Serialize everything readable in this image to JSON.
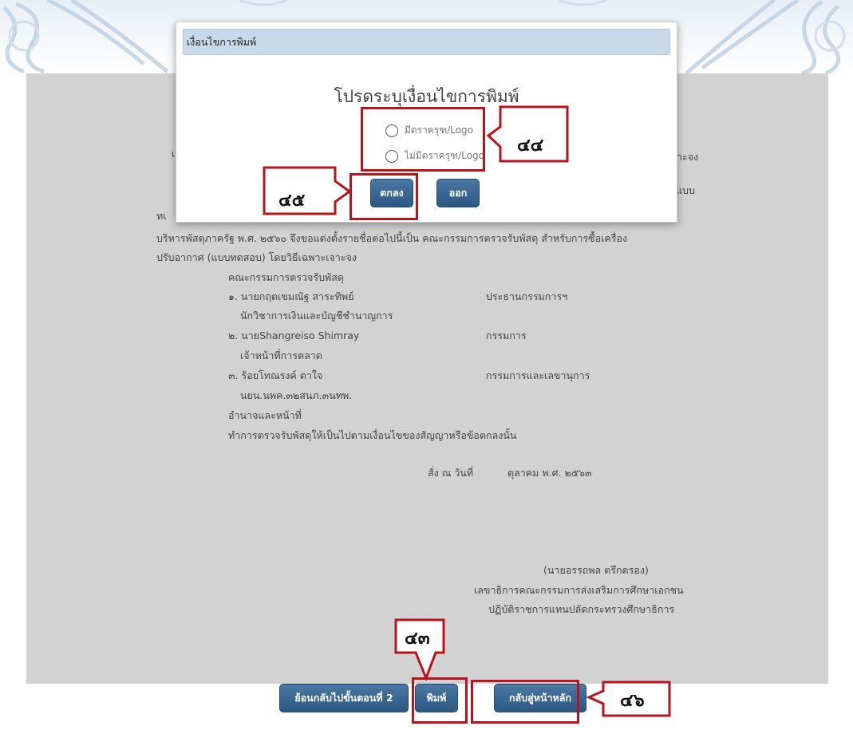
{
  "document": {
    "partial_heading_left": "เ",
    "partial_heading_right": "าะจง",
    "partial_line_right": "แบบ",
    "partial_line_left": "ทเ",
    "paragraph_line1": "บริหารพัสดุภาครัฐ พ.ศ. ๒๕๖๐ จึงขอแต่งตั้งรายชื่อต่อไปนี้เป็น คณะกรรมการตรวจรับพัสดุ สำหรับการซื้อเครื่อง",
    "paragraph_line2": "ปรับอากาศ (แบบทดสอบ) โดยวิธีเฉพาะเจาะจง",
    "committee_heading": "คณะกรรมการตรวจรับพัสดุ",
    "members": [
      {
        "name": "๑. นายกฤตเขมณัฐ สาระทิพย์",
        "position": "นักวิชาการเงินและบัญชีชำนาญการ",
        "role": "ประธานกรรมการฯ"
      },
      {
        "name": "๒. นายShangreiso Shimray",
        "position": "เจ้าหน้าที่การตลาด",
        "role": "กรรมการ"
      },
      {
        "name": "๓. ร้อยโทณรงค์ ตาใจ",
        "position": "นยน.นพค.๓๒สนภ.๓นทพ.",
        "role": "กรรมการและเลขานุการ"
      }
    ],
    "authority_heading": "อำนาจและหน้าที่",
    "authority_text": "ทำการตรวจรับพัสดุให้เป็นไปตามเงื่อนไขของสัญญาหรือข้อตกลงนั้น",
    "order_date_label": "สั่ง ณ วันที่",
    "order_date_value": "ตุลาคม พ.ศ. ๒๕๖๓",
    "signer_name": "(นายอรรถพล ตรึกตรอง)",
    "signer_title1": "เลขาธิการคณะกรรมการส่งเสริมการศึกษาเอกชน",
    "signer_title2": "ปฏิบัติราชการแทนปลัดกระทรวงศึกษาธิการ"
  },
  "modal": {
    "title": "เงื่อนไขการพิมพ์",
    "prompt": "โปรดระบุเงื่อนไขการพิมพ์",
    "options": [
      "มีตราครุฑ/Logo",
      "ไม่มีตราครุฑ/Logo"
    ],
    "ok_label": "ตกลง",
    "exit_label": "ออก"
  },
  "bottom_buttons": {
    "back_label": "ย้อนกลับไปขั้นตอนที่ 2",
    "print_label": "พิมพ์",
    "home_label": "กลับสู่หน้าหลัก"
  },
  "annotations": {
    "callout_43": "๔๓",
    "callout_44": "๔๔",
    "callout_45": "๔๕",
    "callout_46": "๔๖"
  },
  "colors": {
    "annotation_red": "#b8141c",
    "button_blue": "#2c5881",
    "modal_header": "#c8d9e9",
    "document_bg": "#d2d2d2"
  }
}
